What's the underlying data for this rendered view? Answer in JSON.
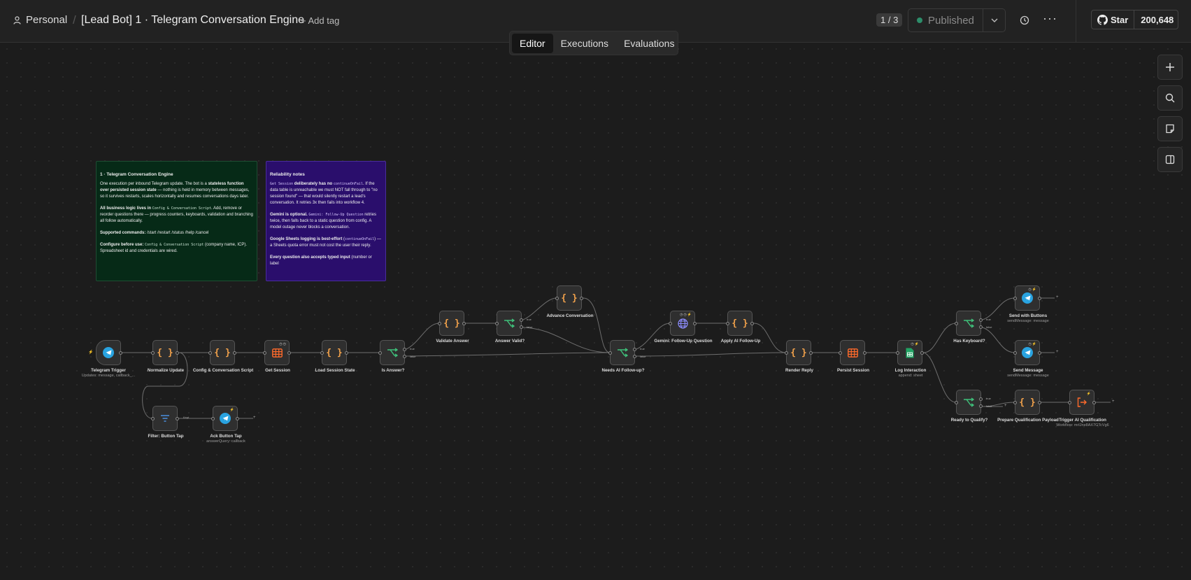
{
  "header": {
    "workspace": "Personal",
    "workflow_title": "[Lead Bot] 1 · Telegram Conversation Engine",
    "add_tag": "+ Add tag",
    "version_pager": "1 / 3",
    "publish_status": "Published",
    "github": {
      "star_label": "Star",
      "star_count": "200,648"
    }
  },
  "tabs": [
    {
      "label": "Editor",
      "active": true
    },
    {
      "label": "Executions",
      "active": false
    },
    {
      "label": "Evaluations",
      "active": false
    }
  ],
  "right_toolbar": [
    "plus-icon",
    "search-icon",
    "sticky-note-icon",
    "panel-toggle-icon"
  ],
  "sticky_notes": {
    "engine": {
      "title": "1 · Telegram Conversation Engine",
      "p1_a": "One execution per inbound Telegram update. The bot is a ",
      "p1_b": "stateless function over persisted session state",
      "p1_c": " — nothing is held in memory between messages, so it survives restarts, scales horizontally and resumes conversations days later.",
      "p2_a": "All business logic lives in ",
      "p2_code": "Config & Conversation Script",
      "p2_b": ". Add, remove or reorder questions there — progress counters, keyboards, validation and branching all follow automatically.",
      "p3_a": "Supported commands:",
      "p3_b": " /start /restart /status /help /cancel",
      "p4_a": "Configure before use:",
      "p4_code": "Config & Conversation Script",
      "p4_b": " (company name, ICP). Spreadsheet id and credentials are wired."
    },
    "reliability": {
      "title": "Reliability notes",
      "p1_code": "Get Session",
      "p1_a": " deliberately has no ",
      "p1_code2": "continueOnFail",
      "p1_b": ". If the data table is unreachable we must NOT fall through to \"no session found\" — that would silently restart a lead's conversation. It retries 3x then fails into workflow 4.",
      "p2_a": "Gemini is optional.",
      "p2_code": "Gemini: Follow-Up Question",
      "p2_b": " retries twice, then falls back to a static question from config. A model outage never blocks a conversation.",
      "p3_a": "Google Sheets logging is best-effort",
      "p3_code": "continueOnFail",
      "p3_b": " — a Sheets quota error must not cost the user their reply.",
      "p4_a": "Every question also accepts typed input",
      "p4_b": " (number or label"
    }
  },
  "nodes": {
    "telegram_trigger": {
      "label": "Telegram Trigger",
      "sub": "Updates: message, callback_..."
    },
    "normalize_update": {
      "label": "Normalize Update"
    },
    "config_script": {
      "label": "Config & Conversation Script"
    },
    "get_session": {
      "label": "Get Session"
    },
    "load_session_state": {
      "label": "Load Session State"
    },
    "is_answer": {
      "label": "Is Answer?"
    },
    "validate_answer": {
      "label": "Validate Answer"
    },
    "answer_valid": {
      "label": "Answer Valid?"
    },
    "advance_conversation": {
      "label": "Advance Conversation"
    },
    "needs_ai_followup": {
      "label": "Needs AI Follow-up?"
    },
    "gemini_followup": {
      "label": "Gemini: Follow-Up Question"
    },
    "apply_ai_followup": {
      "label": "Apply AI Follow-Up"
    },
    "render_reply": {
      "label": "Render Reply"
    },
    "persist_session": {
      "label": "Persist Session"
    },
    "log_interaction": {
      "label": "Log Interaction",
      "sub": "append: sheet"
    },
    "has_keyboard": {
      "label": "Has Keyboard?"
    },
    "send_with_buttons": {
      "label": "Send with Buttons",
      "sub": "sendMessage: message"
    },
    "send_message": {
      "label": "Send Message",
      "sub": "sendMessage: message"
    },
    "ready_to_qualify": {
      "label": "Ready to Qualify?"
    },
    "prepare_qualification": {
      "label": "Prepare Qualification Payload"
    },
    "trigger_ai_qualification": {
      "label": "Trigger AI Qualification",
      "sub": "Workflow: mrIJne8AX7GTcVg6"
    },
    "filter_button_tap": {
      "label": "Filter: Button Tap"
    },
    "ack_button_tap": {
      "label": "Ack Button Tap",
      "sub": "answerQuery: callback"
    }
  },
  "branch_labels": {
    "true": "true",
    "false": "false",
    "kept": "Kept"
  },
  "colors": {
    "accent_orange": "#f2a24b",
    "if_green": "#3fc07a",
    "telegram_blue": "#29a3e0",
    "datatable_orange": "#ff6a2b",
    "sheets_green": "#21a464",
    "filter_blue": "#4a8fe0",
    "gemini_purple": "#8c8cff",
    "sticky_green": "#062a17",
    "sticky_purple": "#2a0e6c"
  }
}
